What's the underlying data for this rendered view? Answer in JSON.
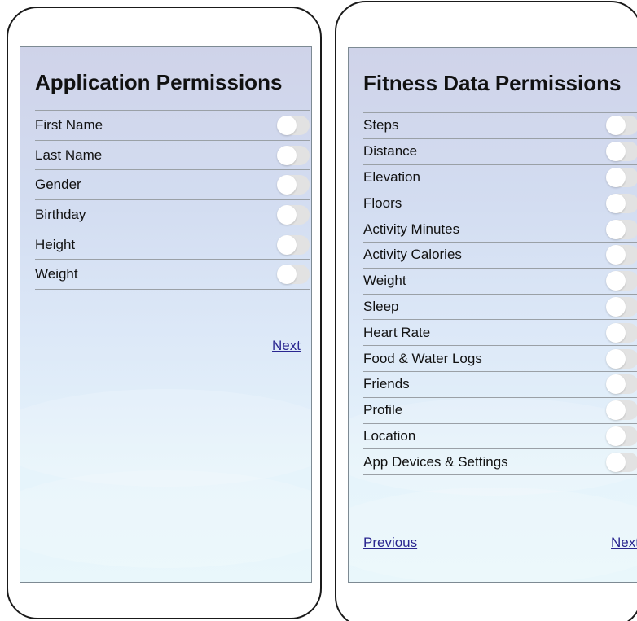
{
  "left_panel": {
    "title": "Application Permissions",
    "items": [
      {
        "label": "First Name",
        "enabled": false
      },
      {
        "label": "Last Name",
        "enabled": false
      },
      {
        "label": "Gender",
        "enabled": false
      },
      {
        "label": "Birthday",
        "enabled": false
      },
      {
        "label": "Height",
        "enabled": false
      },
      {
        "label": "Weight",
        "enabled": false
      }
    ],
    "next_label": "Next"
  },
  "right_panel": {
    "title": "Fitness Data Permissions",
    "items": [
      {
        "label": "Steps",
        "enabled": false
      },
      {
        "label": "Distance",
        "enabled": false
      },
      {
        "label": "Elevation",
        "enabled": false
      },
      {
        "label": "Floors",
        "enabled": false
      },
      {
        "label": "Activity Minutes",
        "enabled": false
      },
      {
        "label": "Activity Calories",
        "enabled": false
      },
      {
        "label": "Weight",
        "enabled": false
      },
      {
        "label": "Sleep",
        "enabled": false
      },
      {
        "label": "Heart Rate",
        "enabled": false
      },
      {
        "label": "Food & Water Logs",
        "enabled": false
      },
      {
        "label": "Friends",
        "enabled": false
      },
      {
        "label": "Profile",
        "enabled": false
      },
      {
        "label": "Location",
        "enabled": false
      },
      {
        "label": "App Devices & Settings",
        "enabled": false
      }
    ],
    "previous_label": "Previous",
    "next_label": "Next"
  },
  "colors": {
    "link": "#2a2690",
    "toggle_off_track": "#e2e2e2",
    "divider": "#9aa0a6"
  }
}
